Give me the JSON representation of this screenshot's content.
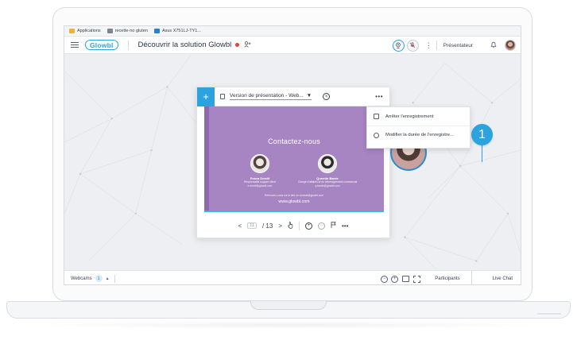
{
  "browser": {
    "bookmarks": [
      {
        "label": "Applications",
        "color": "#f2b233"
      },
      {
        "label": "recette-no gluten",
        "color": "#7c8694"
      },
      {
        "label": "Asus X751LJ-TY1...",
        "color": "#2a7fd4"
      }
    ]
  },
  "app": {
    "logo": "Glowbl",
    "session_title": "Découvrir la solution Glowbl",
    "role": "Présentateur"
  },
  "presentation": {
    "document_name": "Version de présentation - Web...",
    "dropdown_caret": "▼",
    "more": "•••",
    "slide": {
      "title": "Contactez-nous",
      "contacts": [
        {
          "name": "Enora Dordif",
          "role": "Responsable support client",
          "email": "e.dordif@glowbl.com"
        },
        {
          "name": "Quentin Barde",
          "role": "Chargé d'affaires et du développement commercial",
          "email": "q.barde@glowbl.com"
        }
      ],
      "footer_note": "Retrouvez-nous sur le site ou contact@glowbl.com",
      "url": "www.glowbl.com"
    },
    "controls": {
      "prev": "<",
      "page_input": "11",
      "page_total": "/ 13",
      "next": ">",
      "more": "•••"
    }
  },
  "menu": {
    "items": [
      {
        "label": "Arrêter l'enregistrement",
        "icon": "checkbox-icon"
      },
      {
        "label": "Modifier la durée de l'enregistre...",
        "icon": "clock-icon"
      }
    ]
  },
  "callout": {
    "number": "1"
  },
  "bottombar": {
    "webcams_label": "Webcams",
    "webcams_count": "1",
    "chevron": "▲",
    "participants": "Participants",
    "live_chat": "Live Chat"
  },
  "colors": {
    "accent": "#2aa3de",
    "slide_bg": "#a784c2",
    "record": "#e8413c"
  }
}
